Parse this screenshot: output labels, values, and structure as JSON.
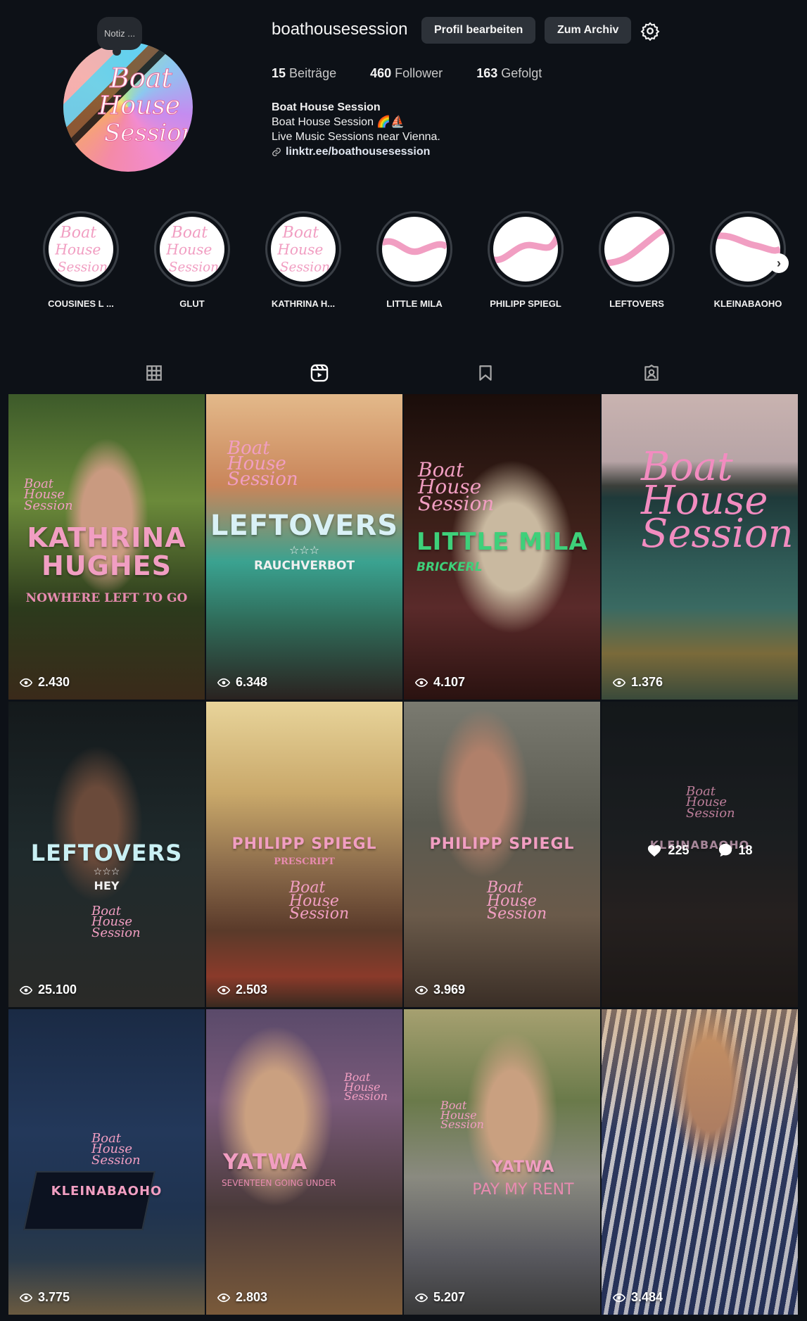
{
  "profile": {
    "note": "Notiz ...",
    "username": "boathousesession",
    "edit_button": "Profil bearbeiten",
    "archive_button": "Zum Archiv",
    "stats": [
      {
        "count": "15",
        "label": "Beiträge"
      },
      {
        "count": "460",
        "label": "Follower"
      },
      {
        "count": "163",
        "label": "Gefolgt"
      }
    ],
    "bio": {
      "name": "Boat House Session",
      "line1": "Boat House Session 🌈⛵",
      "line2": "Live Music Sessions near Vienna.",
      "link": "linktr.ee/boathousesession"
    }
  },
  "highlights": [
    {
      "label": "COUSINES L ..."
    },
    {
      "label": "GLUT"
    },
    {
      "label": "KATHRINA H..."
    },
    {
      "label": "LITTLE MILA"
    },
    {
      "label": "PHILIPP SPIEGL"
    },
    {
      "label": "LEFTOVERS"
    },
    {
      "label": "KLEINABAOHO"
    }
  ],
  "posts": [
    {
      "title": "KATHRINA HUGHES",
      "subtitle": "NOWHERE LEFT TO GO",
      "views": "2.430"
    },
    {
      "title": "LEFTOVERS",
      "subtitle": "RAUCHVERBOT",
      "stars": "☆☆☆",
      "views": "6.348"
    },
    {
      "title": "LITTLE MILA",
      "subtitle": "BRICKERL",
      "views": "4.107"
    },
    {
      "title": "Boat House Session",
      "views": "1.376"
    },
    {
      "title": "LEFTOVERS",
      "subtitle": "HEY",
      "stars": "☆☆☆",
      "views": "25.100"
    },
    {
      "title": "PHILIPP SPIEGL",
      "subtitle": "PRESCRIPT",
      "views": "2.503"
    },
    {
      "title": "PHILIPP SPIEGL",
      "views": "3.969"
    },
    {
      "title": "KLEINABAOHO",
      "likes": "225",
      "comments": "18"
    },
    {
      "title": "KLEINABAOHO",
      "views": "3.775"
    },
    {
      "title": "YATWA",
      "subtitle": "SEVENTEEN GOING UNDER",
      "views": "2.803"
    },
    {
      "title": "YATWA",
      "subtitle": "PAY MY RENT",
      "views": "5.207"
    },
    {
      "title": "",
      "views": "3.484"
    }
  ],
  "colors": {
    "accent_pink": "#f19ec2",
    "bg": "#0d1117",
    "button": "#2d3239",
    "selection": "#3e7bfa"
  }
}
